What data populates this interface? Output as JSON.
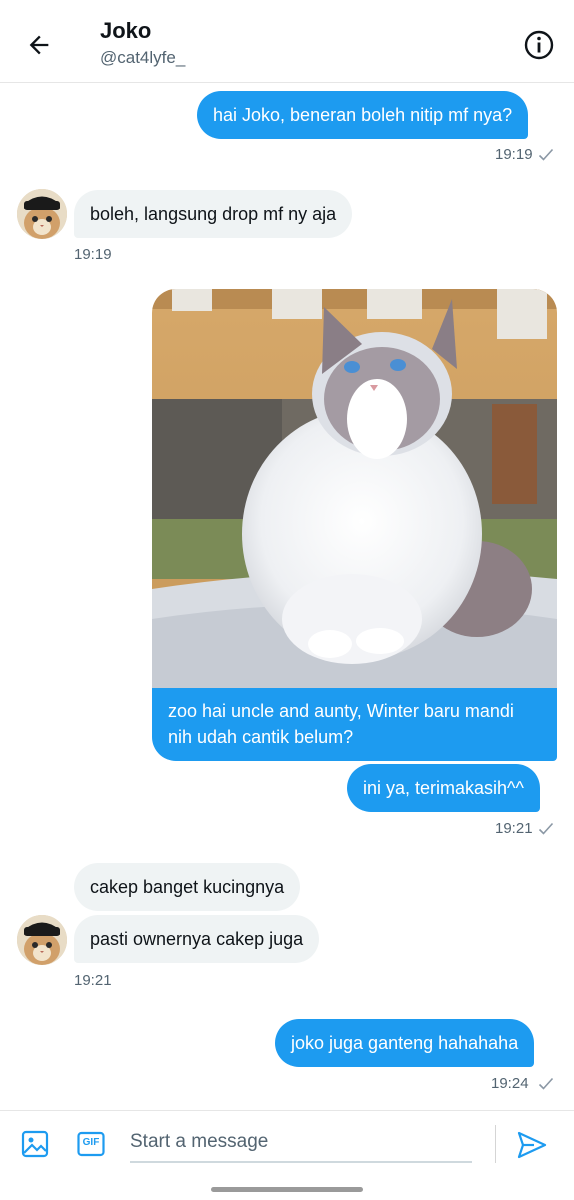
{
  "header": {
    "name": "Joko",
    "handle": "@cat4lyfe_"
  },
  "messages": {
    "m1": {
      "text": "hai Joko, beneran boleh nitip mf nya?",
      "time": "19:19"
    },
    "m2": {
      "text": "boleh, langsung drop mf ny aja",
      "time": "19:19"
    },
    "m3": {
      "caption": "zoo hai uncle and aunty, Winter baru mandi nih udah cantik belum?"
    },
    "m4": {
      "text": "ini ya, terimakasih^^",
      "time": "19:21"
    },
    "m5": {
      "text": "cakep banget kucingnya"
    },
    "m6": {
      "text": "pasti ownernya cakep juga",
      "time": "19:21"
    },
    "m7": {
      "text": "joko juga ganteng hahahaha",
      "time": "19:24"
    }
  },
  "composer": {
    "placeholder": "Start a message",
    "gif_label": "GIF"
  },
  "icons": {
    "back": "arrow-left-icon",
    "info": "info-icon",
    "image": "image-icon",
    "gif": "gif-icon",
    "send": "send-icon",
    "read": "checkmark-icon"
  },
  "colors": {
    "accent": "#1d9bf0",
    "incoming_bubble": "#eff3f4",
    "muted_text": "#536471"
  }
}
